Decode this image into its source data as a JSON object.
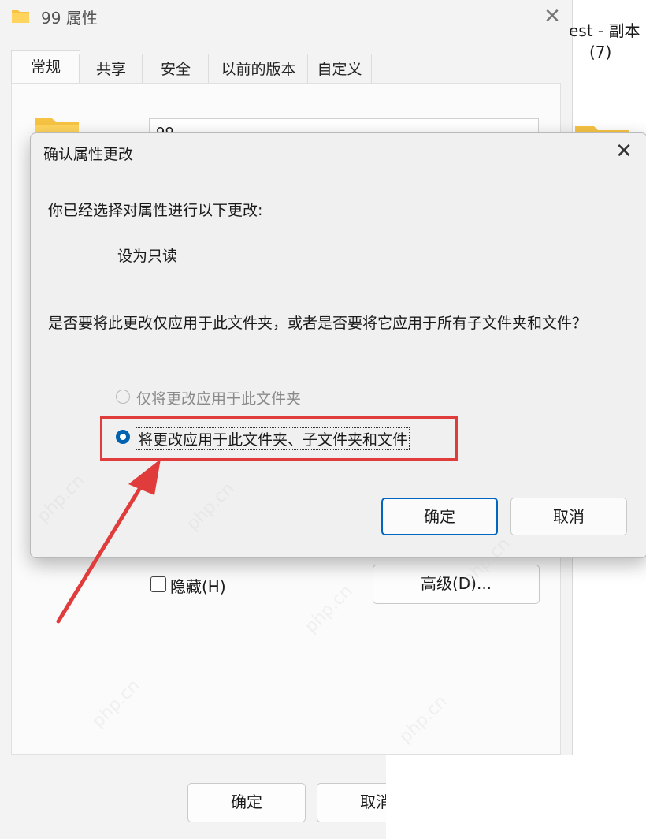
{
  "properties_window": {
    "title": "99 属性",
    "tabs": [
      "常规",
      "共享",
      "安全",
      "以前的版本",
      "自定义"
    ],
    "active_tab": "常规",
    "folder_name_value": "99",
    "hidden_checkbox_label": "隐藏(H)",
    "hidden_checked": false,
    "advanced_button": "高级(D)...",
    "ok_button": "确定",
    "cancel_button": "取消"
  },
  "explorer_background": {
    "item_label_line1": "est - 副本",
    "item_label_line2": "(7)"
  },
  "confirm_dialog": {
    "title": "确认属性更改",
    "prompt": "你已经选择对属性进行以下更改:",
    "change": "设为只读",
    "question": "是否要将此更改仅应用于此文件夹，或者是否要将它应用于所有子文件夹和文件？",
    "options": [
      {
        "label": "仅将更改应用于此文件夹",
        "selected": false
      },
      {
        "label": "将更改应用于此文件夹、子文件夹和文件",
        "selected": true
      }
    ],
    "ok_button": "确定",
    "cancel_button": "取消"
  },
  "colors": {
    "annotation_red": "#e03c3c",
    "accent_blue": "#0067c0",
    "folder_yellow": "#f6c343"
  },
  "watermark_text": "php.cn"
}
